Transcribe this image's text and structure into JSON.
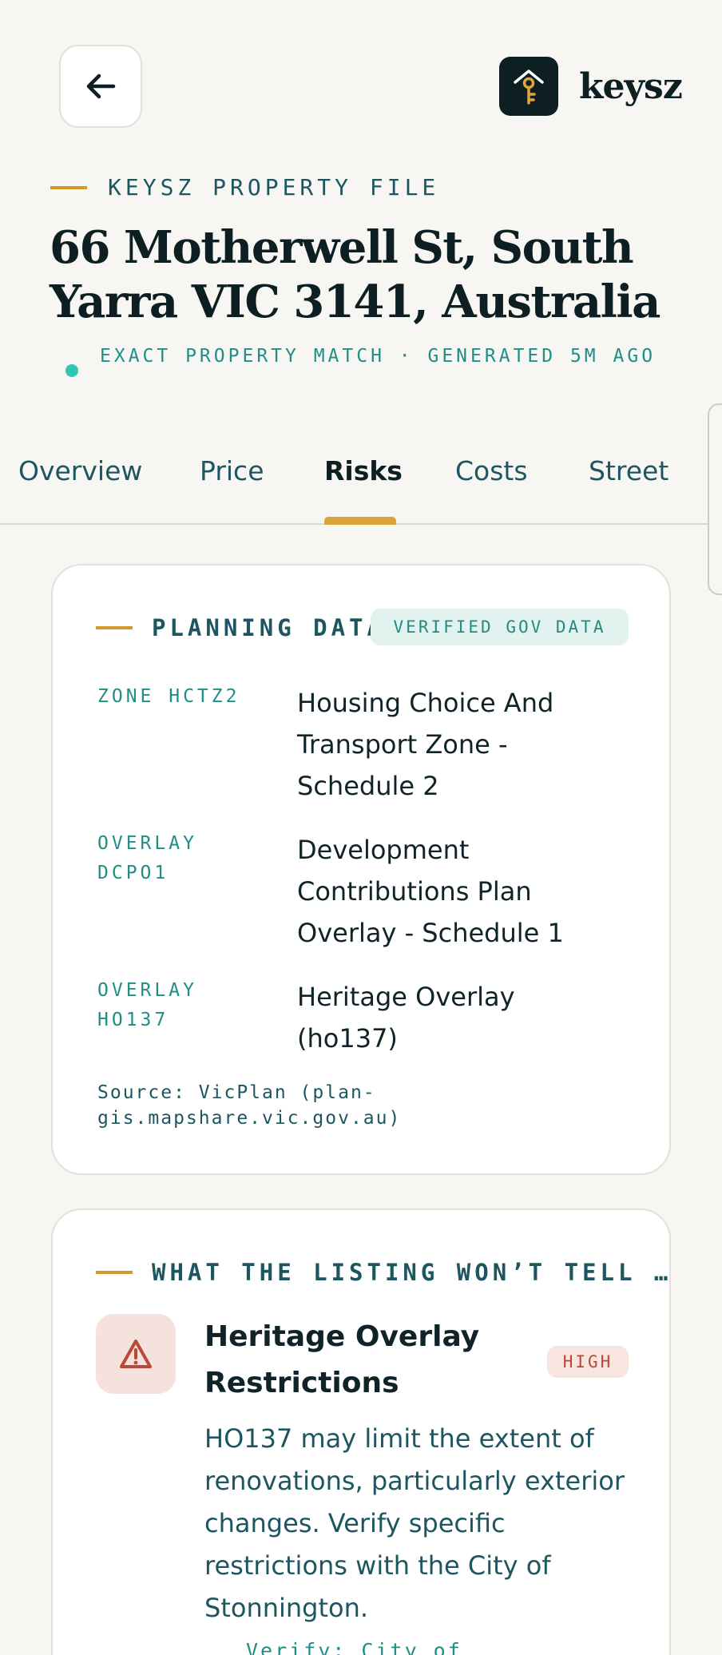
{
  "header": {
    "brand": "keysz",
    "icons": {
      "back": "arrow-left-icon",
      "logo": "house-key-icon"
    }
  },
  "file": {
    "eyebrow": "KEYSZ PROPERTY FILE",
    "address": "66 Motherwell St, South Yarra VIC 3141, Australia",
    "match_status": "EXACT PROPERTY MATCH  ·  GENERATED 5M AGO"
  },
  "tabs": [
    {
      "label": "Overview"
    },
    {
      "label": "Price"
    },
    {
      "label": "Risks"
    },
    {
      "label": "Costs"
    },
    {
      "label": "Street"
    }
  ],
  "active_tab": "Risks",
  "planning": {
    "heading": "PLANNING DATA",
    "badge": "VERIFIED GOV DATA",
    "rows": [
      {
        "label": "ZONE HCTZ2",
        "value": "Housing Choice And Transport Zone - Schedule 2"
      },
      {
        "label": "OVERLAY DCPO1",
        "value": "Development Contributions Plan Overlay - Schedule 1"
      },
      {
        "label": "OVERLAY HO137",
        "value": "Heritage Overlay (ho137)"
      }
    ],
    "source": "Source: VicPlan (plan-gis.mapshare.vic.gov.au)"
  },
  "risks": {
    "heading": "WHAT THE LISTING WON’T TELL …",
    "items": [
      {
        "icon": "warning-triangle-icon",
        "title": "Heritage Overlay Restrictions",
        "severity": "HIGH",
        "description": "HO137 may limit the extent of renovations, particularly exterior changes. Verify specific restrictions with the City of Stonnington.",
        "verify": "Verify: City of"
      }
    ]
  },
  "colors": {
    "background": "#f7f6f3",
    "accent": "#d29a2c",
    "teal": "#1f8f86",
    "dark": "#0d1f22",
    "danger": "#b94a38"
  }
}
